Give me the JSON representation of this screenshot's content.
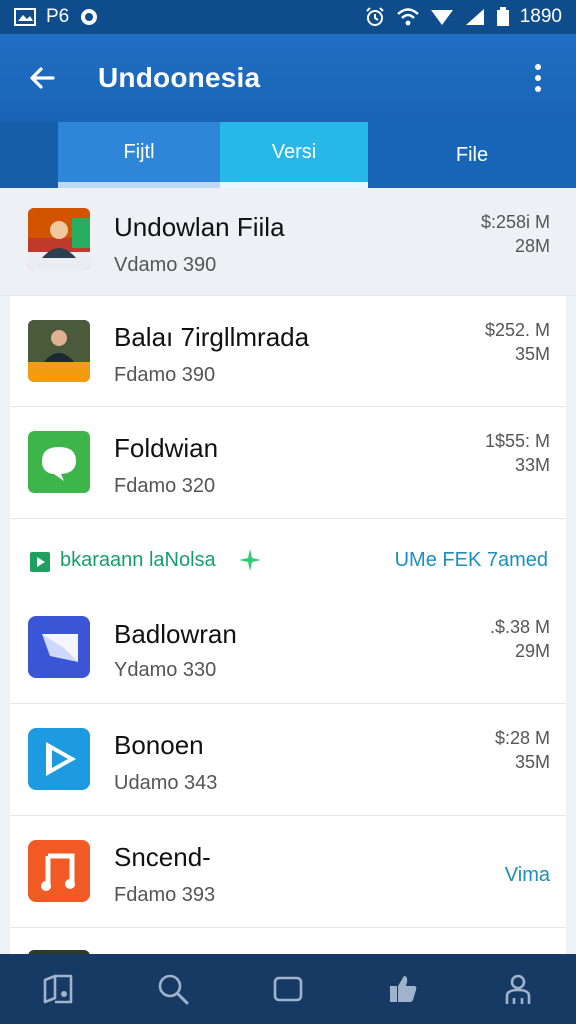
{
  "status_bar": {
    "left_text": "P6",
    "time": "1890",
    "icons": [
      "gallery-icon",
      "notification-circle-icon",
      "alarm-icon",
      "wifi-icon",
      "signal-icon",
      "cellular-icon",
      "battery-icon"
    ]
  },
  "app_bar": {
    "title": "Undoonesia",
    "back_icon": "arrow-left-icon",
    "menu_icon": "more-vert-icon"
  },
  "tabs": [
    {
      "label": "Fijtl",
      "active": false
    },
    {
      "label": "Versi",
      "active": true
    },
    {
      "label": "File",
      "active": false
    }
  ],
  "apps": [
    {
      "name": "Undowlan Fiila",
      "sub": "Vdamo 390",
      "price": "$:258i M",
      "size": "28M",
      "icon": "photo-thumbnail-icon"
    },
    {
      "name": "Balaı 7irgllmrada",
      "sub": "Fdamo 390",
      "price": "$252. M",
      "size": "35M",
      "icon": "photo-thumbnail-icon"
    },
    {
      "name": "Foldwian",
      "sub": "Fdamo 320",
      "price": "1$55: M",
      "size": "33M",
      "icon": "chat-bubble-icon"
    }
  ],
  "promo": {
    "text": "bkaraann laNolsa",
    "link": "UMe FEK 7amed",
    "colors": {
      "text": "#159e6a",
      "link": "#1a8fc0"
    }
  },
  "apps_after_promo": [
    {
      "name": "Badlowran",
      "sub": "Ydamo 330",
      "price": ".$.38 M",
      "size": "29M",
      "icon": "send-arrow-icon"
    },
    {
      "name": "Bonoen",
      "sub": "Udamo 343",
      "price": "$:28 M",
      "size": "35M",
      "icon": "play-triangle-icon"
    },
    {
      "name": "Sncend-",
      "sub": "Fdamo 393",
      "price": "",
      "size": "",
      "link": "Vima",
      "icon": "music-note-icon"
    }
  ],
  "bottom_nav": [
    "library-icon",
    "search-icon",
    "square-icon",
    "thumbs-up-icon",
    "person-icon"
  ],
  "colors": {
    "status_bar": "#0f4c8c",
    "app_bar": "#1f6fc4",
    "tab_active": "#27b8ea",
    "bottom_nav": "#173a64"
  }
}
